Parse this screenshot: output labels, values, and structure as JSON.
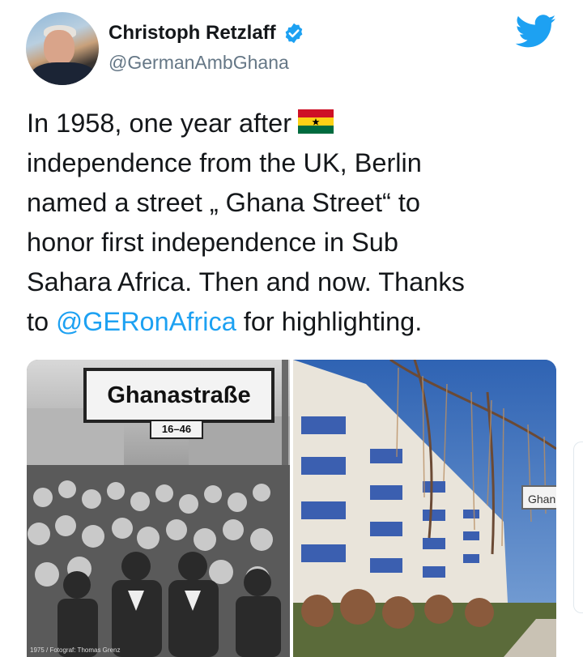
{
  "author": {
    "name": "Christoph Retzlaff",
    "handle": "@GermanAmbGhana"
  },
  "icons": {
    "avatar": "profile-photo",
    "verified": "verified-badge-icon",
    "logo": "twitter-bird-icon",
    "flag": "ghana-flag-emoji"
  },
  "tweet": {
    "line1": "In 1958, one year after",
    "line2": " independence from the UK, Berlin",
    "line3": "named a street „ Ghana Street“ to",
    "line4": "honor first independence in Sub",
    "line5": "Sahara Africa. Then and now. Thanks",
    "line6_pre": "to ",
    "mention": "@GERonAfrica",
    "line6_post": " for highlighting."
  },
  "media": {
    "left_sign": "Ghanastraße",
    "left_subsign": "16–46",
    "left_credit": "1975 / Fotograf: Thomas Grenz",
    "right_sign": "Ghan"
  },
  "colors": {
    "link": "#1da1f2",
    "twitter_blue": "#1da1f2",
    "handle_gray": "#657786",
    "text": "#14171a"
  }
}
